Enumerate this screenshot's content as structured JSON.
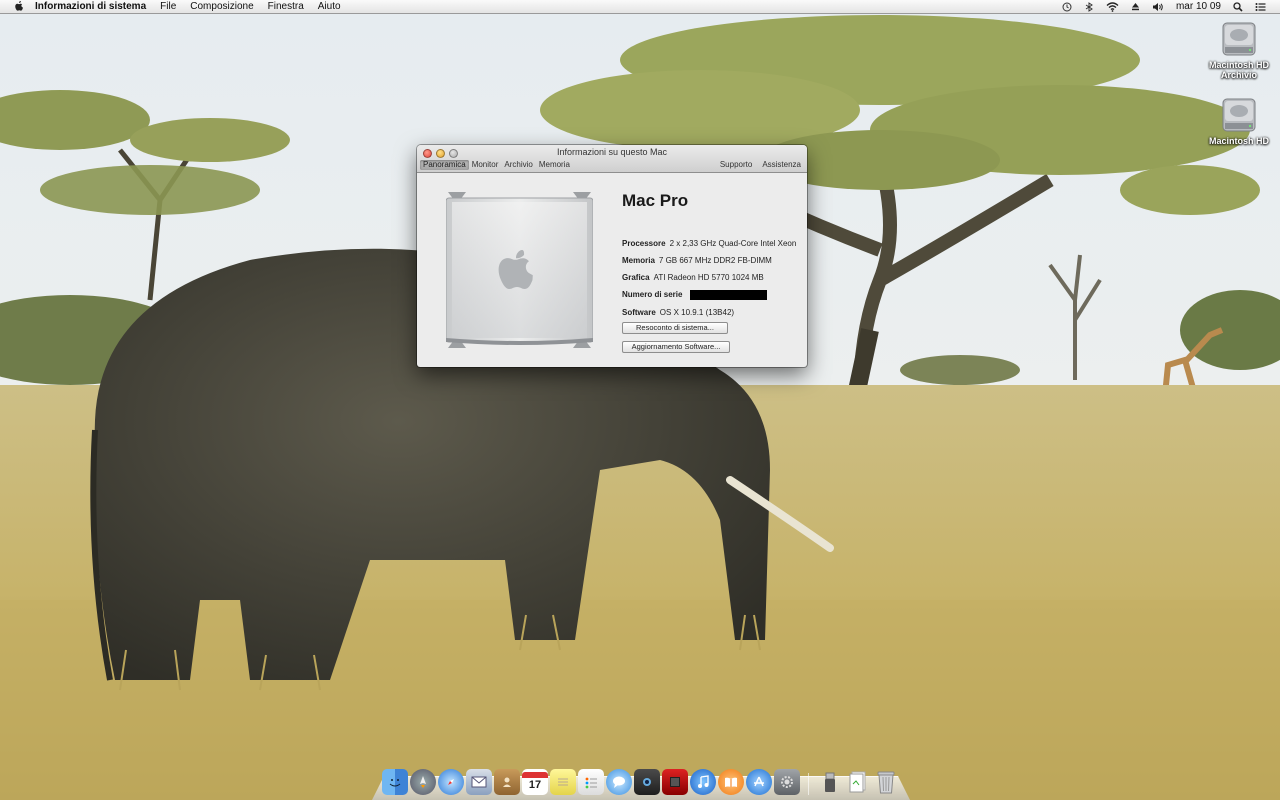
{
  "menubar": {
    "app_name": "Informazioni di sistema",
    "items": [
      "File",
      "Composizione",
      "Finestra",
      "Aiuto"
    ],
    "clock": "mar 10 09",
    "status_icons": [
      "time-machine-icon",
      "bluetooth-icon",
      "wifi-icon",
      "eject-icon",
      "volume-icon"
    ]
  },
  "desktop_icons": [
    {
      "label": "Macintosh HD Archivio"
    },
    {
      "label": "Macintosh HD"
    }
  ],
  "window": {
    "title": "Informazioni su questo Mac",
    "tabs": [
      "Panoramica",
      "Monitor",
      "Archivio",
      "Memoria"
    ],
    "selected_tab": "Panoramica",
    "right_links": [
      "Supporto",
      "Assistenza"
    ],
    "model": "Mac Pro",
    "specs": {
      "processor_label": "Processore",
      "processor_value": "2 x 2,33 GHz Quad-Core Intel Xeon",
      "memory_label": "Memoria",
      "memory_value": "7 GB 667 MHz DDR2 FB-DIMM",
      "graphics_label": "Grafica",
      "graphics_value": "ATI Radeon HD 5770 1024 MB",
      "serial_label": "Numero di serie",
      "software_label": "Software",
      "software_value": "OS X 10.9.1 (13B42)"
    },
    "buttons": {
      "system_report": "Resoconto di sistema...",
      "software_update": "Aggiornamento Software..."
    }
  },
  "dock": {
    "items": [
      "finder-icon",
      "launchpad-icon",
      "safari-icon",
      "mail-icon",
      "contacts-icon",
      "calendar-icon",
      "notes-icon",
      "reminders-icon",
      "messages-icon",
      "facetime-icon",
      "photo-booth-icon",
      "itunes-icon",
      "ibooks-icon",
      "app-store-icon",
      "system-preferences-icon",
      "usb-drive-icon",
      "documents-icon",
      "trash-icon"
    ],
    "calendar_day": "17"
  }
}
